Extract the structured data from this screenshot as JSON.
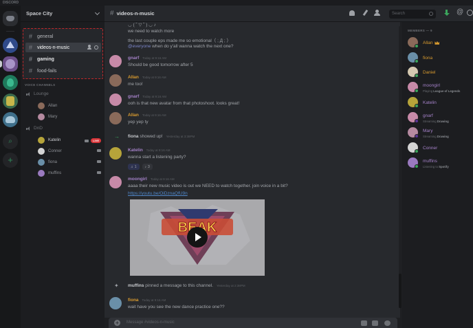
{
  "app": {
    "title": "DISCORD"
  },
  "server": {
    "name": "Space City"
  },
  "text_channels": [
    {
      "name": "general",
      "state": "normal"
    },
    {
      "name": "videos-n-music",
      "state": "active"
    },
    {
      "name": "gaming",
      "state": "unread"
    },
    {
      "name": "food-fails",
      "state": "normal"
    }
  ],
  "voice": {
    "header": "VOICE CHANNELS",
    "channels": [
      {
        "name": "Lounge",
        "users": [
          "Allan",
          "Mary"
        ]
      },
      {
        "name": "DnD",
        "users": [
          "Katelin",
          "Conner",
          "fiona",
          "muffins"
        ]
      }
    ],
    "live_label": "LIVE"
  },
  "channel_header": {
    "name": "videos-n-music",
    "search_placeholder": "Search"
  },
  "messages": {
    "intro_line0": "◡ ( ˘ ▽ ˘ ) ◡ ♪",
    "intro_line1": "we need to watch more",
    "intro_line2": "the last couple eps made me so emotional（ ; Д ; ）",
    "intro_line3_mention": "@everyone",
    "intro_line3_rest": " when do y'all wanna watch the next one?",
    "m1": {
      "author": "gnarf",
      "time": "Today at 9:16 AM",
      "text": "Should be good tomorrow after 5"
    },
    "m2": {
      "author": "Allan",
      "time": "Today at 9:16 AM",
      "text": "me too!"
    },
    "m3": {
      "author": "gnarf",
      "time": "Today at 9:16 AM",
      "text": "ooh is that new avatar from that photoshoot. looks great!"
    },
    "m4": {
      "author": "Allan",
      "time": "Today at 9:16 AM",
      "text": "yep yep ty"
    },
    "sys1": {
      "author": "fiona",
      "text": " showed up!",
      "time": "Yesterday at 3:38PM"
    },
    "m5": {
      "author": "Katelin",
      "time": "Today at 9:16 AM",
      "text": "wanna start a listening party?",
      "react1": "1",
      "react2": "3"
    },
    "m6": {
      "author": "moongirl",
      "time": "Today at 9:16 AM",
      "text": "aaaa their new music video is out we NEED to watch together. join voice in a bit?",
      "link": "https://youtu.be/OiDznaQfU9n"
    },
    "embed_logo": "BEAK",
    "sys2": {
      "author": "muffins",
      "text": " pinned a message to this channel.",
      "time": "Yesterday at 2:38PM"
    },
    "m7": {
      "author": "fiona",
      "time": "Today at 9:16 AM",
      "text": "wait have you see the new dance practice one??"
    }
  },
  "input": {
    "placeholder": "Message #videos-n-music"
  },
  "members": {
    "header": "MEMBERS — 9",
    "list": [
      {
        "name": "Allan",
        "color": "#d99b2f",
        "activity": ""
      },
      {
        "name": "fiona",
        "color": "#d99b2f",
        "activity": ""
      },
      {
        "name": "Daniel",
        "color": "#d99b2f",
        "activity": ""
      },
      {
        "name": "moongirl",
        "color": "#a582c9",
        "activity_prefix": "Playing ",
        "activity": "League of Legends"
      },
      {
        "name": "Katelin",
        "color": "#a582c9",
        "activity": ""
      },
      {
        "name": "gnarf",
        "color": "#a582c9",
        "activity_prefix": "Streaming ",
        "activity": "Drawing"
      },
      {
        "name": "Mary",
        "color": "#a582c9",
        "activity_prefix": "Streaming ",
        "activity": "Drawing"
      },
      {
        "name": "Conner",
        "color": "#a582c9",
        "activity": ""
      },
      {
        "name": "muffins",
        "color": "#a582c9",
        "activity_prefix": "Listening to ",
        "activity": "Spotify"
      }
    ]
  },
  "colors": {
    "accent": "#5865f2",
    "live": "#d8363a",
    "online": "#3ba55c",
    "highlight_box": "#c4272a"
  }
}
